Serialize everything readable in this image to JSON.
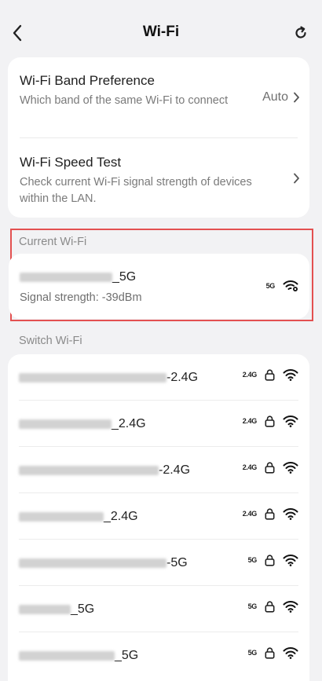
{
  "header": {
    "title": "Wi-Fi",
    "back_icon": "chevron-left-icon",
    "refresh_icon": "refresh-icon"
  },
  "settings": {
    "band_preference": {
      "title": "Wi-Fi Band Preference",
      "subtitle": "Which band of the same Wi-Fi to connect",
      "value": "Auto"
    },
    "speed_test": {
      "title": "Wi-Fi Speed Test",
      "subtitle": "Check current Wi-Fi signal strength of devices within the LAN."
    }
  },
  "current_wifi": {
    "section_label": "Current Wi-Fi",
    "ssid_suffix": "_5G",
    "signal_text": "Signal strength: -39dBm",
    "band": "5G"
  },
  "switch_wifi": {
    "section_label": "Switch Wi-Fi",
    "networks": [
      {
        "ssid_suffix": "-2.4G",
        "band": "2.4G"
      },
      {
        "ssid_suffix": "_2.4G",
        "band": "2.4G"
      },
      {
        "ssid_suffix": "-2.4G",
        "band": "2.4G"
      },
      {
        "ssid_suffix": "_2.4G",
        "band": "2.4G"
      },
      {
        "ssid_suffix": "-5G",
        "band": "5G"
      },
      {
        "ssid_suffix": "_5G",
        "band": "5G"
      },
      {
        "ssid_suffix": "_5G",
        "band": "5G"
      }
    ]
  },
  "colors": {
    "background": "#f2f2f4",
    "card": "#ffffff",
    "highlight": "#e35050",
    "secondary_text": "#7a7a7a"
  }
}
